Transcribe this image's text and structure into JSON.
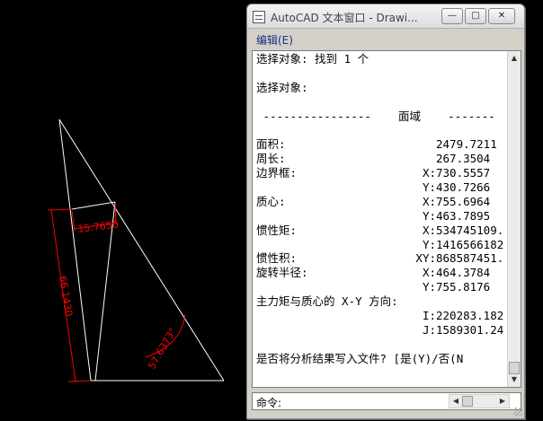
{
  "drawing": {
    "dim_labels": [
      "15.7650",
      "66.1430",
      "57.6373°"
    ],
    "line_color": "#ffffff",
    "dim_color": "#ff0000"
  },
  "window": {
    "title": "AutoCAD 文本窗口 - Drawi...",
    "buttons": {
      "minimize": "—",
      "maximize": "□",
      "close": "✕"
    },
    "menu": {
      "edit": "编辑(E)"
    }
  },
  "output": {
    "line1": "选择对象: 找到 1 个",
    "line2": "",
    "line3": "选择对象:",
    "line4": "",
    "line5": " ----------------    面域    -------",
    "line6": "",
    "area_label": "面积:",
    "area_value": "2479.7211",
    "perimeter_label": "周长:",
    "perimeter_value": "267.3504",
    "bbox_label": "边界框:",
    "bbox_x": "730.5557",
    "bbox_y": "430.7266",
    "centroid_label": "质心:",
    "centroid_x": "755.6964",
    "centroid_y": "463.7895",
    "moi_label": "惯性矩:",
    "moi_x": "534745109.",
    "moi_y": "1416566182",
    "poi_label": "惯性积:",
    "poi_xy": "868587451.",
    "rog_label": "旋转半径:",
    "rog_x": "464.3784",
    "rog_y": "755.8176",
    "principal_label": "主力矩与质心的 X-Y 方向:",
    "principal_i": "220283.182",
    "principal_j": "1589301.24",
    "axis_x": "X:",
    "axis_y": "Y:",
    "axis_xy": "XY:",
    "axis_i": "I:",
    "axis_j": "J:",
    "prompt": "是否将分析结果写入文件? [是(Y)/否(N"
  },
  "command": {
    "label": "命令:"
  },
  "scrollbar": {
    "up": "▲",
    "down": "▼",
    "left": "◀",
    "right": "▶"
  }
}
